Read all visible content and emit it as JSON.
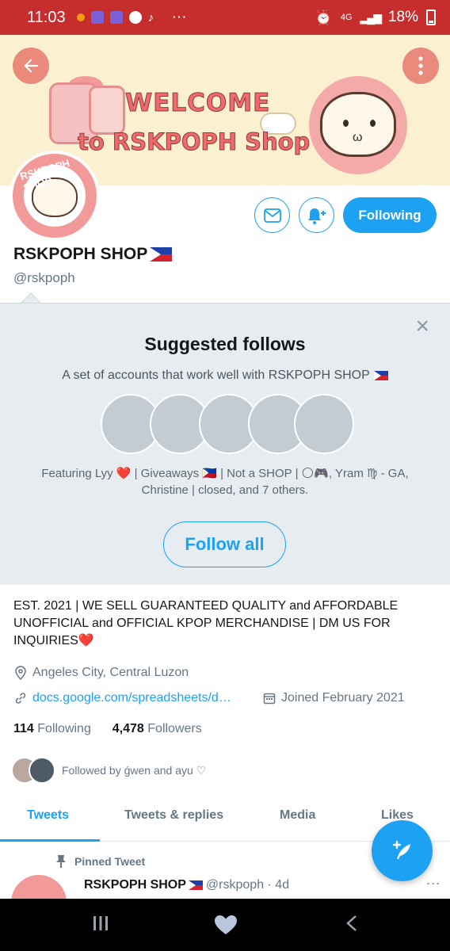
{
  "status_bar": {
    "time": "11:03",
    "dots": "···",
    "network": "4G",
    "battery": "18%"
  },
  "profile": {
    "banner_line1": "WELCOME",
    "banner_line2": "to RSKPOPH Shop",
    "avatar_label": "RSKPOPH SHOP",
    "name": "RSKPOPH SHOP",
    "handle": "@rskpoph",
    "following_button": "Following",
    "bio": "EST. 2021 | WE SELL GUARANTEED QUALITY and AFFORDABLE UNOFFICIAL and OFFICIAL KPOP MERCHANDISE | DM US FOR INQUIRIES",
    "location": "Angeles City, Central Luzon",
    "link": "docs.google.com/spreadsheets/d…",
    "joined": "Joined February 2021",
    "following_count": "114",
    "following_label": "Following",
    "followers_count": "4,478",
    "followers_label": "Followers",
    "followed_by": "Followed by ǵwen and ayu ♡"
  },
  "suggested": {
    "title": "Suggested follows",
    "subtitle": "A set of accounts that work well with RSKPOPH SHOP",
    "featuring_1": "Featuring Lyy ❤️ | Giveaways 🇵🇭 | Not a SHOP | 🌕🎮, Yram ♍ - GA,",
    "featuring_2": "Christine | closed, and 7 others.",
    "follow_all": "Follow all",
    "close": "×"
  },
  "tabs": [
    {
      "label": "Tweets"
    },
    {
      "label": "Tweets & replies"
    },
    {
      "label": "Media"
    },
    {
      "label": "Likes"
    }
  ],
  "pinned": {
    "label": "Pinned Tweet",
    "author": "RSKPOPH SHOP",
    "handle_time": "@rskpoph · 4d"
  },
  "colors": {
    "accent": "#1da1f2",
    "status_bar": "#c62d2d",
    "banner_bg": "#fbf0cf",
    "suggest_bg": "#e6ecf0"
  },
  "icons": {
    "back": "arrow-left-icon",
    "more": "more-vertical-icon",
    "message": "envelope-icon",
    "notify": "bell-plus-icon",
    "location": "map-pin-icon",
    "link": "link-icon",
    "joined": "calendar-icon",
    "pin": "pin-icon",
    "compose": "compose-feather-icon"
  }
}
